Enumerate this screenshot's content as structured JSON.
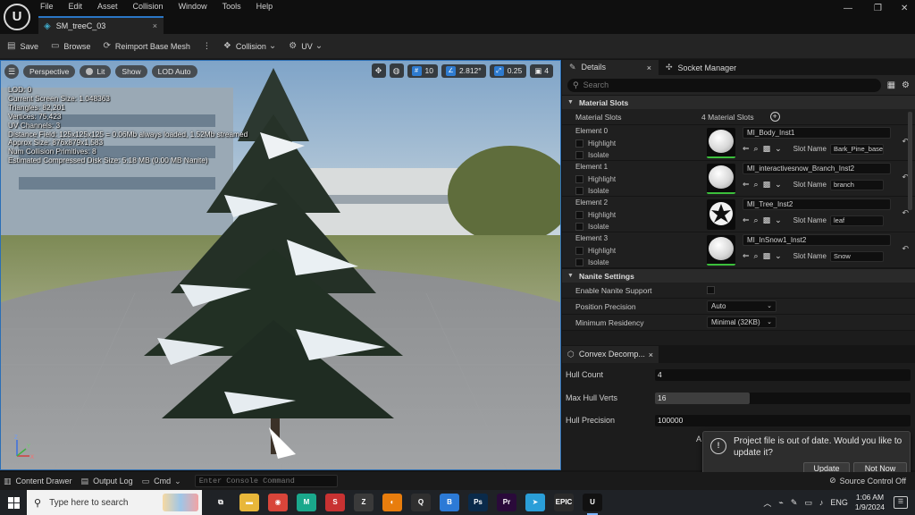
{
  "app": {
    "logo_icon": "unreal-engine-logo-icon",
    "menu": [
      "File",
      "Edit",
      "Asset",
      "Collision",
      "Window",
      "Tools",
      "Help"
    ],
    "tab_title": "SM_treeC_03",
    "tab_close": "×"
  },
  "window_controls": {
    "minimize": "—",
    "restore": "❐",
    "close": "✕"
  },
  "toolbar": {
    "save": "Save",
    "browse": "Browse",
    "reimport": "Reimport Base Mesh",
    "more": "⋮",
    "collision": "Collision",
    "uv": "UV"
  },
  "viewport": {
    "menu_icon": "☰",
    "perspective": "Perspective",
    "lit": "Lit",
    "show": "Show",
    "lod": "LOD Auto",
    "grid_value": "10",
    "angle_value": "2.812°",
    "scale_value": "0.25",
    "camera_speed": "4",
    "stats": [
      "LOD:  0",
      "Current Screen Size:  1.048363",
      "Triangles:  82,201",
      "Vertices:  75,423",
      "UV Channels:  3",
      "Distance Field:  125x125x125 = 0.06Mb always loaded, 1.52Mb streamed",
      "Approx Size: 876x879x1,583",
      "Num Collision Primitives:  8",
      "Estimated Compressed Disk Size: 5.18 MB (0.00 MB Nanite)"
    ],
    "axis_z": "Z",
    "axis_y": "Y",
    "axis_x": "X"
  },
  "details": {
    "tab_details": "Details",
    "tab_close": "×",
    "tab_socket": "Socket Manager",
    "search_placeholder": "Search",
    "material_slots_header": "Material Slots",
    "material_slots_label": "Material Slots",
    "material_slots_count": "4 Material Slots",
    "highlight_label": "Highlight",
    "isolate_label": "Isolate",
    "slot_name_label": "Slot Name",
    "elements": [
      {
        "title": "Element 0",
        "material": "MI_Body_Inst1",
        "slot": "Bark_Pine_baseC"
      },
      {
        "title": "Element 1",
        "material": "MI_interactivesnow_Branch_Inst2",
        "slot": "branch"
      },
      {
        "title": "Element 2",
        "material": "MI_Tree_Inst2",
        "slot": "leaf"
      },
      {
        "title": "Element 3",
        "material": "MI_InSnow1_Inst2",
        "slot": "Snow"
      }
    ],
    "nanite_header": "Nanite Settings",
    "nanite_enable": "Enable Nanite Support",
    "position_precision_label": "Position Precision",
    "position_precision_value": "Auto",
    "minimum_residency_label": "Minimum Residency",
    "minimum_residency_value": "Minimal (32KB)"
  },
  "convex": {
    "tab": "Convex Decomp...",
    "tab_close": "×",
    "hull_count_label": "Hull Count",
    "hull_count_value": "4",
    "hull_count_fraction": 0.0,
    "max_hull_verts_label": "Max Hull Verts",
    "max_hull_verts_value": "16",
    "max_hull_verts_fraction": 0.37,
    "hull_precision_label": "Hull Precision",
    "hull_precision_value": "100000",
    "hull_precision_fraction": 0.0,
    "apply_stub": "A"
  },
  "toast": {
    "message": "Project file is out of date. Would you like to update it?",
    "update": "Update",
    "not_now": "Not Now"
  },
  "statusbar": {
    "content_drawer": "Content Drawer",
    "output_log": "Output Log",
    "cmd": "Cmd",
    "console_placeholder": "Enter Console Command",
    "source_control": "Source Control Off"
  },
  "taskbar": {
    "search_placeholder": "Type here to search",
    "apps": [
      {
        "name": "task-view",
        "label": "⧉",
        "color": "#1f2226"
      },
      {
        "name": "file-explorer",
        "label": "▬",
        "color": "#e8b73a"
      },
      {
        "name": "chrome",
        "label": "◉",
        "color": "#d8453a"
      },
      {
        "name": "app-m",
        "label": "M",
        "color": "#1aa88c"
      },
      {
        "name": "app-s",
        "label": "S",
        "color": "#c83232"
      },
      {
        "name": "app-z",
        "label": "Z",
        "color": "#3a3a3a"
      },
      {
        "name": "blender",
        "label": "◐",
        "color": "#e87d0d"
      },
      {
        "name": "app-q",
        "label": "Q",
        "color": "#2f2f2f"
      },
      {
        "name": "app-b",
        "label": "B",
        "color": "#2c7ad6"
      },
      {
        "name": "photoshop",
        "label": "Ps",
        "color": "#0a2a4a"
      },
      {
        "name": "premiere",
        "label": "Pr",
        "color": "#2a0a3a"
      },
      {
        "name": "telegram",
        "label": "➤",
        "color": "#2a9ed8"
      },
      {
        "name": "epic-games",
        "label": "EPIC",
        "color": "#2a2a2a"
      },
      {
        "name": "unreal",
        "label": "U",
        "color": "#111111"
      }
    ],
    "language": "ENG",
    "time": "1:06 AM",
    "date": "1/9/2024"
  }
}
